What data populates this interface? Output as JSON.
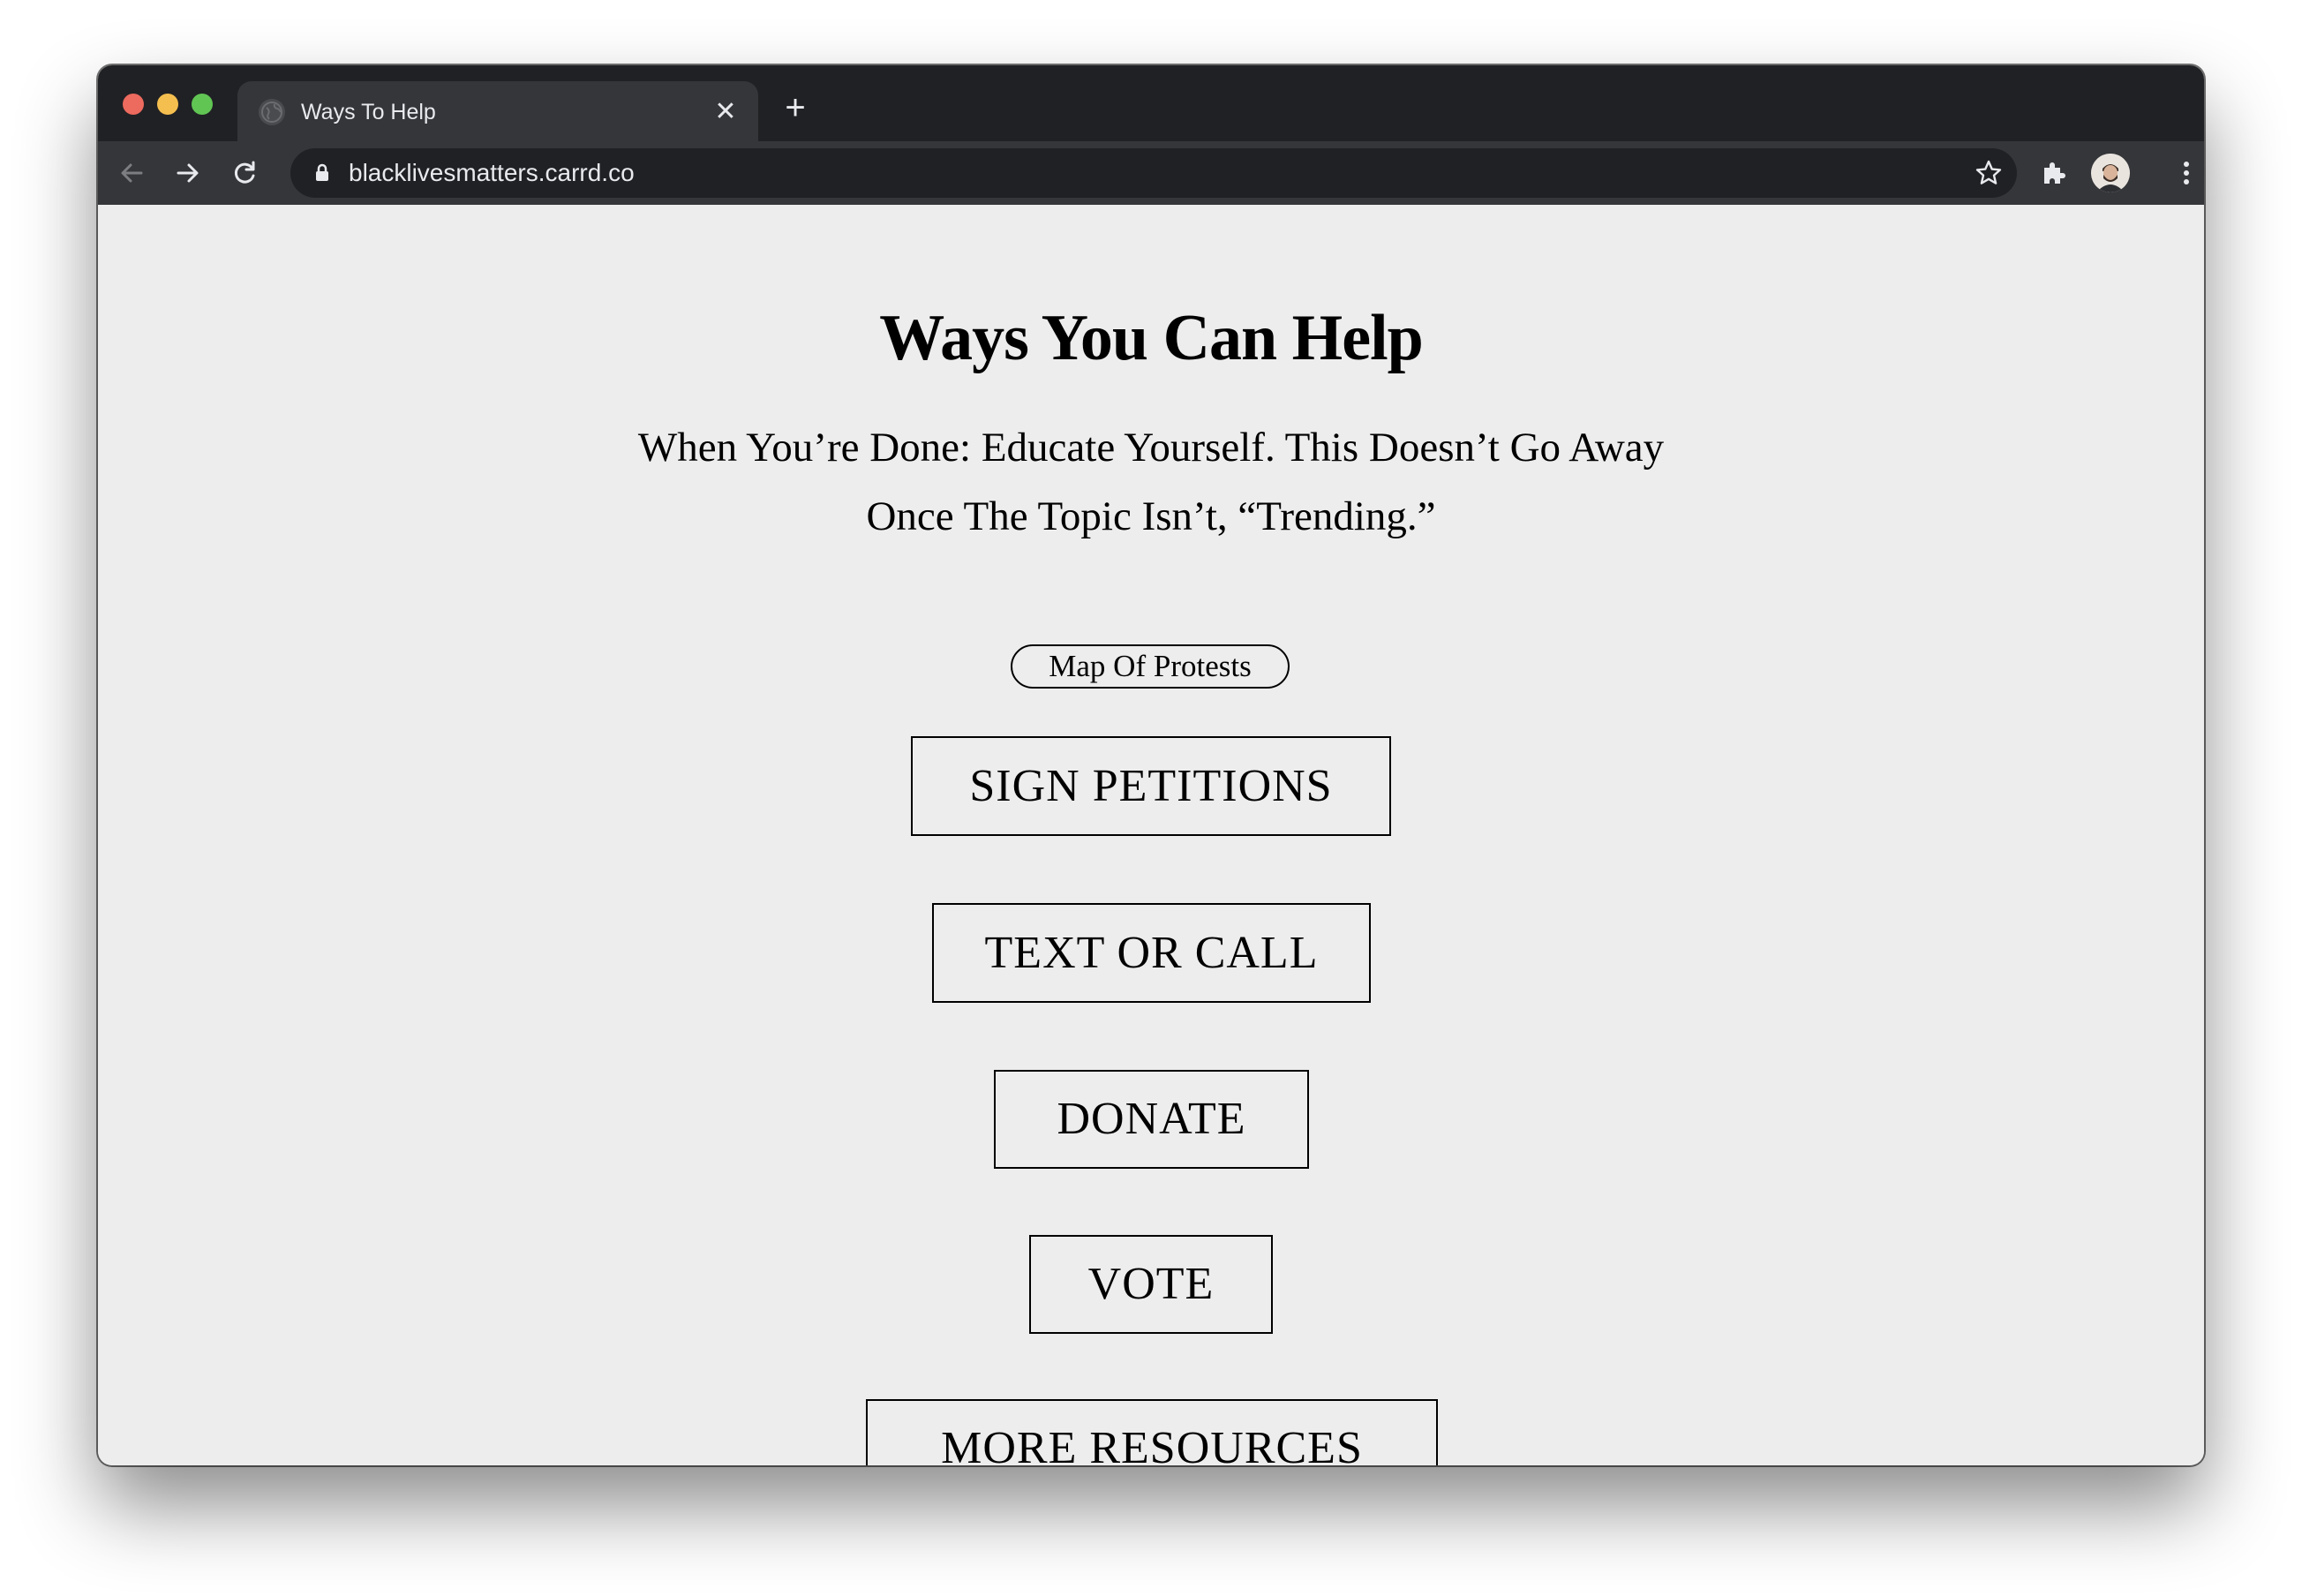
{
  "browser": {
    "tab": {
      "title": "Ways To Help",
      "close_glyph": "✕",
      "favicon": "globe-icon"
    },
    "new_tab_glyph": "+",
    "address": {
      "url": "blacklivesmatters.carrd.co"
    },
    "icons": [
      "back-icon",
      "forward-icon",
      "reload-icon",
      "lock-icon",
      "star-icon",
      "extensions-icon",
      "avatar",
      "more-icon"
    ]
  },
  "page": {
    "title": "Ways You Can Help",
    "subtitle": "When You’re Done: Educate Yourself. This Doesn’t Go Away Once The Topic Isn’t, “Trending.”",
    "map_link": "Map Of Protests",
    "buttons": [
      {
        "label": "SIGN PETITIONS"
      },
      {
        "label": "TEXT OR CALL"
      },
      {
        "label": "DONATE"
      },
      {
        "label": "VOTE"
      },
      {
        "label": "MORE RESOURCES"
      }
    ]
  },
  "colors": {
    "titlebar": "#202124",
    "toolbar": "#35363a",
    "page_background": "#ededed",
    "text": "#000000"
  }
}
